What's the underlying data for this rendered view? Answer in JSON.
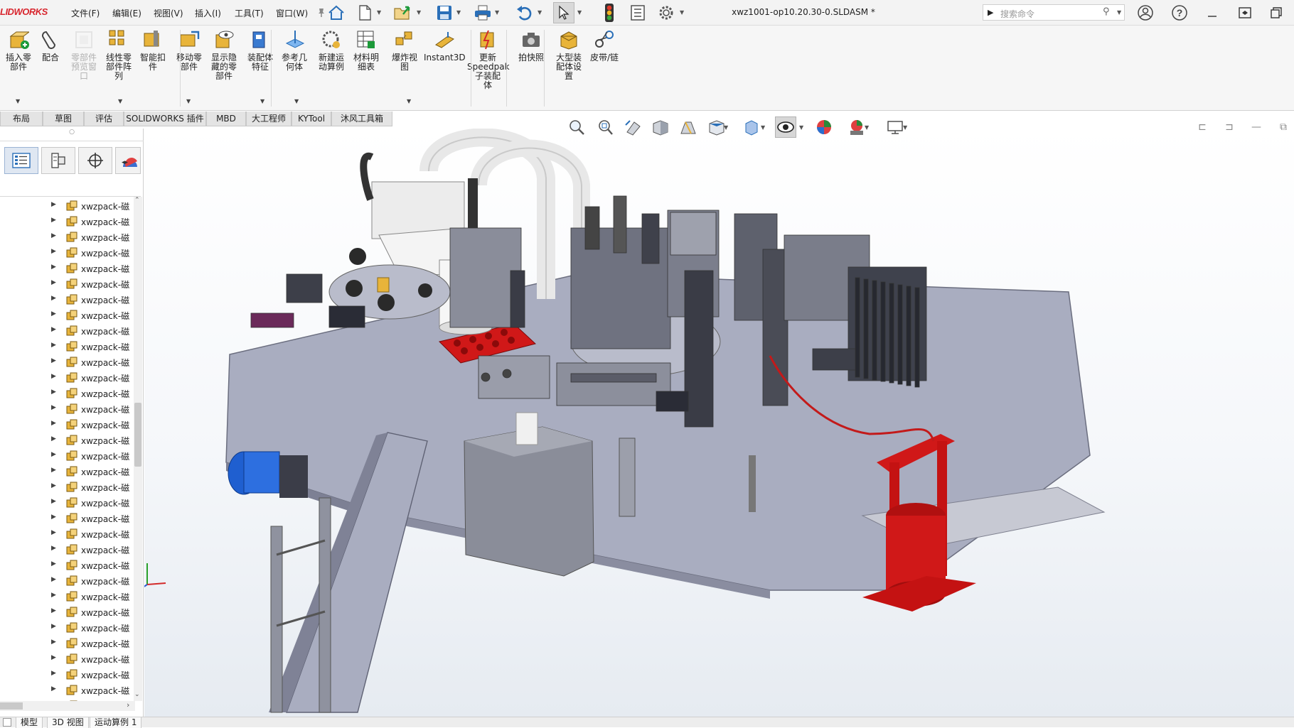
{
  "app": {
    "logo_text": "LIDWORKS",
    "document_title": "xwz1001-op10.20.30-0.SLDASM *"
  },
  "menu": [
    "文件(F)",
    "编辑(E)",
    "视图(V)",
    "插入(I)",
    "工具(T)",
    "窗口(W)"
  ],
  "search": {
    "prompt": "▶",
    "placeholder": "搜索命令"
  },
  "ribbon": [
    {
      "label": "插入零\n部件",
      "icon": "insert-component-icon"
    },
    {
      "label": "配合",
      "icon": "mate-icon"
    },
    {
      "label": "零部件\n预览窗\n口",
      "icon": "component-preview-icon",
      "disabled": true
    },
    {
      "label": "线性零\n部件阵\n列",
      "icon": "linear-pattern-icon"
    },
    {
      "label": "智能扣\n件",
      "icon": "smart-fasteners-icon"
    },
    {
      "label": "移动零\n部件",
      "icon": "move-component-icon"
    },
    {
      "label": "显示隐\n藏的零\n部件",
      "icon": "show-hidden-icon"
    },
    {
      "label": "装配体\n特征",
      "icon": "assembly-feature-icon"
    },
    {
      "label": "参考几\n何体",
      "icon": "reference-geometry-icon"
    },
    {
      "label": "新建运\n动算例",
      "icon": "motion-study-icon"
    },
    {
      "label": "材料明\n细表",
      "icon": "bom-icon"
    },
    {
      "label": "爆炸视\n图",
      "icon": "exploded-view-icon"
    },
    {
      "label": "Instant3D",
      "icon": "instant3d-icon"
    },
    {
      "label": "更新\nSpeedpak\n子装配\n体",
      "icon": "speedpak-icon"
    },
    {
      "label": "拍快照",
      "icon": "snapshot-icon"
    },
    {
      "label": "大型装\n配体设\n置",
      "icon": "large-assembly-icon"
    },
    {
      "label": "皮带/链",
      "icon": "belt-chain-icon"
    }
  ],
  "tabs": [
    "布局",
    "草图",
    "评估",
    "SOLIDWORKS 插件",
    "MBD",
    "大工程师",
    "KYTool",
    "沐风工具箱"
  ],
  "tree": {
    "item_label": "xwzpack-磁",
    "item_count": 33
  },
  "bottom_tabs": [
    "模型",
    "3D 视图",
    "运动算例 1"
  ],
  "colors": {
    "brand_red": "#d8262e",
    "plate": "#a9adc0",
    "tray_red": "#d01818",
    "motor_blue": "#1f5fd0",
    "part_yellow": "#e8b43a"
  }
}
